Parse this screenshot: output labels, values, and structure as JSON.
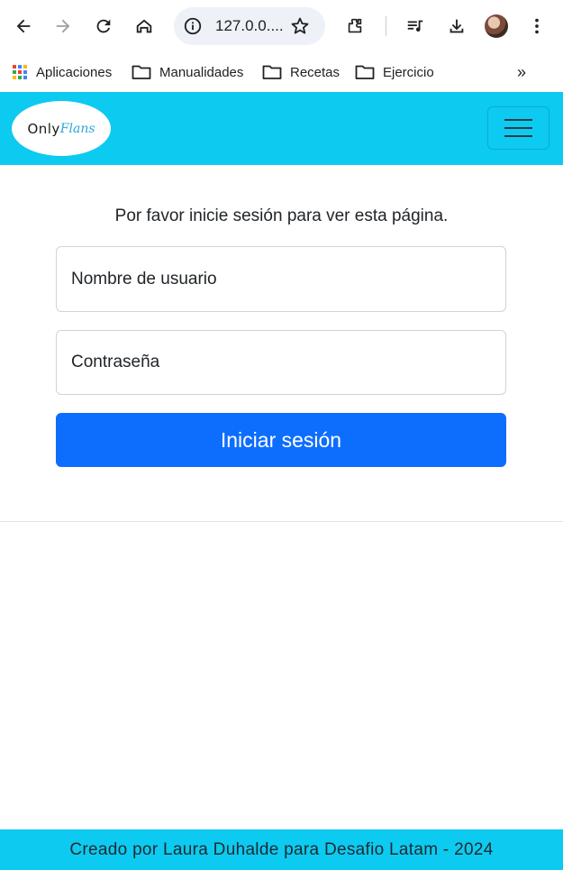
{
  "browser": {
    "url": "127.0.0....",
    "icons": [
      "back-icon",
      "forward-icon",
      "reload-icon",
      "home-icon",
      "site-info-icon",
      "bookmark-star-icon",
      "extensions-icon",
      "media-icon",
      "download-icon",
      "avatar",
      "menu-icon"
    ]
  },
  "bookmarks": {
    "items": [
      {
        "label": "Aplicaciones",
        "icon": "apps-icon"
      },
      {
        "label": "Manualidades",
        "icon": "folder-icon"
      },
      {
        "label": "Recetas",
        "icon": "folder-icon"
      },
      {
        "label": "Ejercicio",
        "icon": "folder-icon"
      }
    ],
    "more_label": "»"
  },
  "navbar": {
    "logo_only": "Only",
    "logo_fans": "Flans",
    "color": "#0dcaf0"
  },
  "login": {
    "prompt": "Por favor inicie sesión para ver esta página.",
    "username_placeholder": "Nombre de usuario",
    "password_placeholder": "Contraseña",
    "submit_label": "Iniciar sesión",
    "button_color": "#0d6efd"
  },
  "footer": {
    "text": "Creado por Laura Duhalde para Desafio Latam - 2024"
  }
}
